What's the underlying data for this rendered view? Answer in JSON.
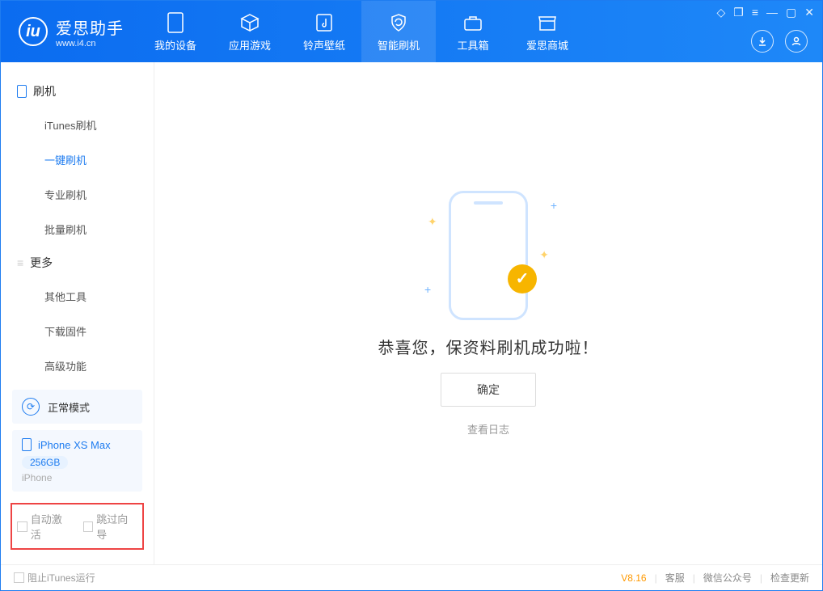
{
  "app": {
    "name_cn": "爱思助手",
    "name_en": "www.i4.cn"
  },
  "nav_tabs": [
    {
      "label": "我的设备"
    },
    {
      "label": "应用游戏"
    },
    {
      "label": "铃声壁纸"
    },
    {
      "label": "智能刷机",
      "active": true
    },
    {
      "label": "工具箱"
    },
    {
      "label": "爱思商城"
    }
  ],
  "sidebar": {
    "group1": {
      "title": "刷机",
      "items": [
        {
          "label": "iTunes刷机"
        },
        {
          "label": "一键刷机",
          "active": true
        },
        {
          "label": "专业刷机"
        },
        {
          "label": "批量刷机"
        }
      ]
    },
    "group2": {
      "title": "更多",
      "items": [
        {
          "label": "其他工具"
        },
        {
          "label": "下载固件"
        },
        {
          "label": "高级功能"
        }
      ]
    },
    "mode": {
      "label": "正常模式"
    },
    "device": {
      "name": "iPhone XS Max",
      "capacity": "256GB",
      "type": "iPhone"
    },
    "options": {
      "auto_activate": "自动激活",
      "skip_guide": "跳过向导"
    }
  },
  "main": {
    "success_msg": "恭喜您，保资料刷机成功啦！",
    "ok_label": "确定",
    "log_link": "查看日志"
  },
  "statusbar": {
    "block_itunes": "阻止iTunes运行",
    "version": "V8.16",
    "links": [
      "客服",
      "微信公众号",
      "检查更新"
    ]
  }
}
